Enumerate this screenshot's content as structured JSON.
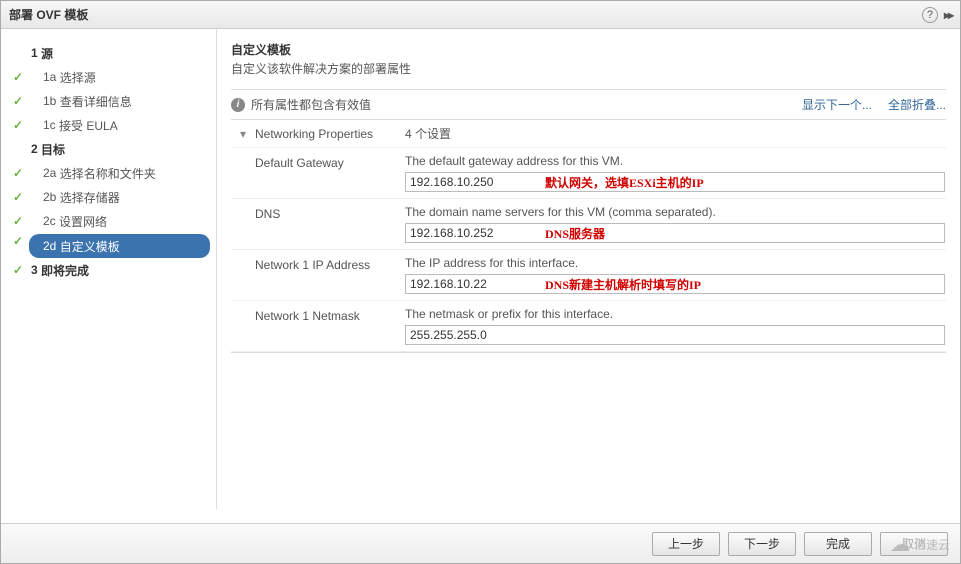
{
  "window": {
    "title": "部署 OVF 模板"
  },
  "sidebar": {
    "s1": {
      "num": "1",
      "label": "源"
    },
    "s1a": {
      "num": "1a",
      "label": "选择源"
    },
    "s1b": {
      "num": "1b",
      "label": "查看详细信息"
    },
    "s1c": {
      "num": "1c",
      "label": "接受 EULA"
    },
    "s2": {
      "num": "2",
      "label": "目标"
    },
    "s2a": {
      "num": "2a",
      "label": "选择名称和文件夹"
    },
    "s2b": {
      "num": "2b",
      "label": "选择存储器"
    },
    "s2c": {
      "num": "2c",
      "label": "设置网络"
    },
    "s2d": {
      "num": "2d",
      "label": "自定义模板"
    },
    "s3": {
      "num": "3",
      "label": "即将完成"
    }
  },
  "main": {
    "title": "自定义模板",
    "subtitle": "自定义该软件解决方案的部署属性",
    "info_text": "所有属性都包含有效值",
    "link_next": "显示下一个...",
    "link_collapse": "全部折叠...",
    "section_name": "Networking Properties",
    "section_count": "4 个设置"
  },
  "props": {
    "gateway": {
      "name": "Default Gateway",
      "desc": "The default gateway address for this VM.",
      "value": "192.168.10.250",
      "annot": "默认网关，选填ESXi主机的IP"
    },
    "dns": {
      "name": "DNS",
      "desc": "The domain name servers for this VM (comma separated).",
      "value": "192.168.10.252",
      "annot": "DNS服务器"
    },
    "ip": {
      "name": "Network 1 IP Address",
      "desc": "The IP address for this interface.",
      "value": "192.168.10.22",
      "annot": "DNS新建主机解析时填写的IP"
    },
    "netmask": {
      "name": "Network 1 Netmask",
      "desc": "The netmask or prefix for this interface.",
      "value": "255.255.255.0"
    }
  },
  "footer": {
    "back": "上一步",
    "next": "下一步",
    "finish": "完成",
    "cancel": "取消"
  },
  "watermark": "亿速云"
}
